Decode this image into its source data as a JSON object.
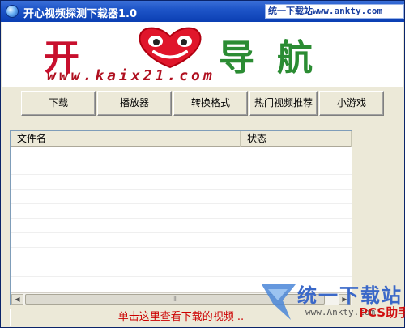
{
  "window": {
    "title": "开心视频探测下载器1.0",
    "watermark_site": "统一下载站",
    "watermark_url": "www.ankty.com"
  },
  "banner": {
    "logo_chars": [
      "开",
      "导",
      "航"
    ],
    "logo_url": "www.kaix21.com"
  },
  "toolbar": {
    "buttons": [
      "下载",
      "播放器",
      "转换格式",
      "热门视频推荐",
      "小游戏"
    ]
  },
  "list": {
    "columns": [
      "文件名",
      "状态"
    ],
    "scroll_thumb_glyph": "III"
  },
  "bottom_link": "单击这里查看下载的视频 ..",
  "corner_watermark": {
    "title": "统一下载站",
    "url": "www.Ankty.com",
    "red_text": "PCS助手"
  },
  "colors": {
    "titlebar": "#1e55c8",
    "logo_red": "#c8102e",
    "logo_green": "#2b8c33",
    "link_red": "#cc0000"
  },
  "icons": {
    "app": "app-globe-icon",
    "scroll_left": "scroll-left-arrow-icon",
    "scroll_right": "scroll-right-arrow-icon"
  }
}
